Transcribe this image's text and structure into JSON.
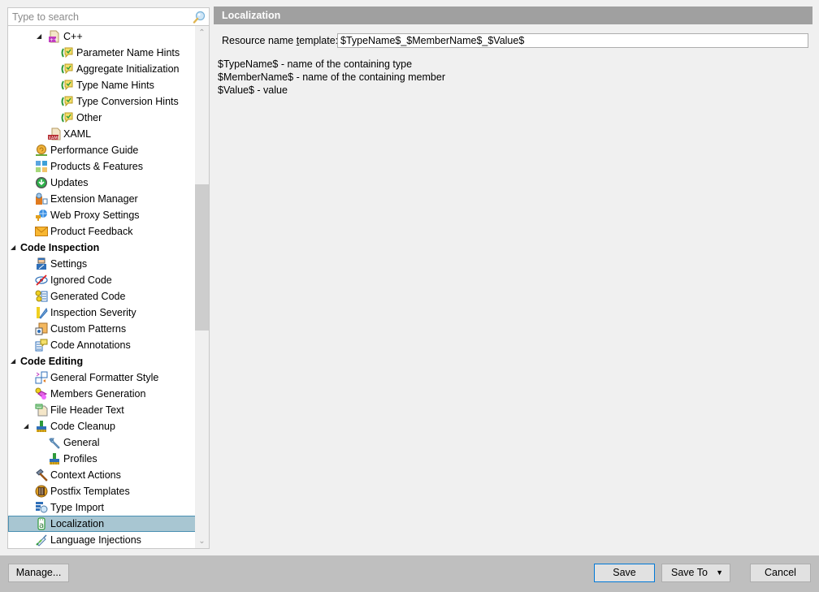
{
  "search": {
    "placeholder": "Type to search",
    "value": ""
  },
  "tree": {
    "items": [
      {
        "label": "C++",
        "level": 2,
        "expander": "expanded",
        "icon": "cpp-file-icon"
      },
      {
        "label": "Parameter Name Hints",
        "level": 4,
        "icon": "inlay-hint-icon"
      },
      {
        "label": "Aggregate Initialization",
        "level": 4,
        "icon": "inlay-hint-icon"
      },
      {
        "label": "Type Name Hints",
        "level": 4,
        "icon": "inlay-hint-icon"
      },
      {
        "label": "Type Conversion Hints",
        "level": 4,
        "icon": "inlay-hint-icon"
      },
      {
        "label": "Other",
        "level": 4,
        "icon": "inlay-hint-icon"
      },
      {
        "label": "XAML",
        "level": 3,
        "icon": "xaml-file-icon"
      },
      {
        "label": "Performance Guide",
        "level": 1,
        "icon": "snail-icon"
      },
      {
        "label": "Products & Features",
        "level": 1,
        "icon": "tiles-icon"
      },
      {
        "label": "Updates",
        "level": 1,
        "icon": "download-circle-icon"
      },
      {
        "label": "Extension Manager",
        "level": 1,
        "icon": "extension-icon"
      },
      {
        "label": "Web Proxy Settings",
        "level": 1,
        "icon": "globe-plug-icon"
      },
      {
        "label": "Product Feedback",
        "level": 1,
        "icon": "envelope-icon"
      },
      {
        "label": "Code Inspection",
        "level": 0,
        "expander": "expanded",
        "group": true
      },
      {
        "label": "Settings",
        "level": 1,
        "icon": "inspector-icon"
      },
      {
        "label": "Ignored Code",
        "level": 1,
        "icon": "eye-crossed-icon"
      },
      {
        "label": "Generated Code",
        "level": 1,
        "icon": "generated-code-icon"
      },
      {
        "label": "Inspection Severity",
        "level": 1,
        "icon": "severity-icon"
      },
      {
        "label": "Custom Patterns",
        "level": 1,
        "icon": "patterns-icon"
      },
      {
        "label": "Code Annotations",
        "level": 1,
        "icon": "annotations-icon"
      },
      {
        "label": "Code Editing",
        "level": 0,
        "expander": "expanded",
        "group": true
      },
      {
        "label": "General Formatter Style",
        "level": 1,
        "icon": "formatter-icon"
      },
      {
        "label": "Members Generation",
        "level": 1,
        "icon": "members-icon"
      },
      {
        "label": "File Header Text",
        "level": 1,
        "icon": "file-header-icon"
      },
      {
        "label": "Code Cleanup",
        "level": 1,
        "expander": "expanded",
        "icon": "broom-icon"
      },
      {
        "label": "General",
        "level": 2,
        "icon": "wrench-icon"
      },
      {
        "label": "Profiles",
        "level": 2,
        "icon": "broom-icon"
      },
      {
        "label": "Context Actions",
        "level": 1,
        "icon": "hammer-icon"
      },
      {
        "label": "Postfix Templates",
        "level": 1,
        "icon": "postfix-icon"
      },
      {
        "label": "Type Import",
        "level": 1,
        "icon": "type-import-icon"
      },
      {
        "label": "Localization",
        "level": 1,
        "icon": "localization-icon",
        "selected": true
      },
      {
        "label": "Language Injections",
        "level": 1,
        "icon": "syringe-icon"
      }
    ]
  },
  "page": {
    "title": "Localization",
    "field_label_pre": "Resource name ",
    "field_label_mnemonic": "t",
    "field_label_post": "emplate:",
    "template_value": "$TypeName$_$MemberName$_$Value$",
    "help": [
      "$TypeName$ - name of the containing type",
      "$MemberName$ - name of the containing member",
      "$Value$ - value"
    ]
  },
  "footer": {
    "manage_label": "Manage...",
    "save_label": "Save",
    "save_to_label": "Save To",
    "cancel_label": "Cancel"
  },
  "colors": {
    "selection_bg": "#a8c6d2",
    "selection_border": "#4a90b2",
    "header_bg": "#a0a0a0",
    "footer_bg": "#bfbfbf",
    "default_button_border": "#0078d7"
  }
}
